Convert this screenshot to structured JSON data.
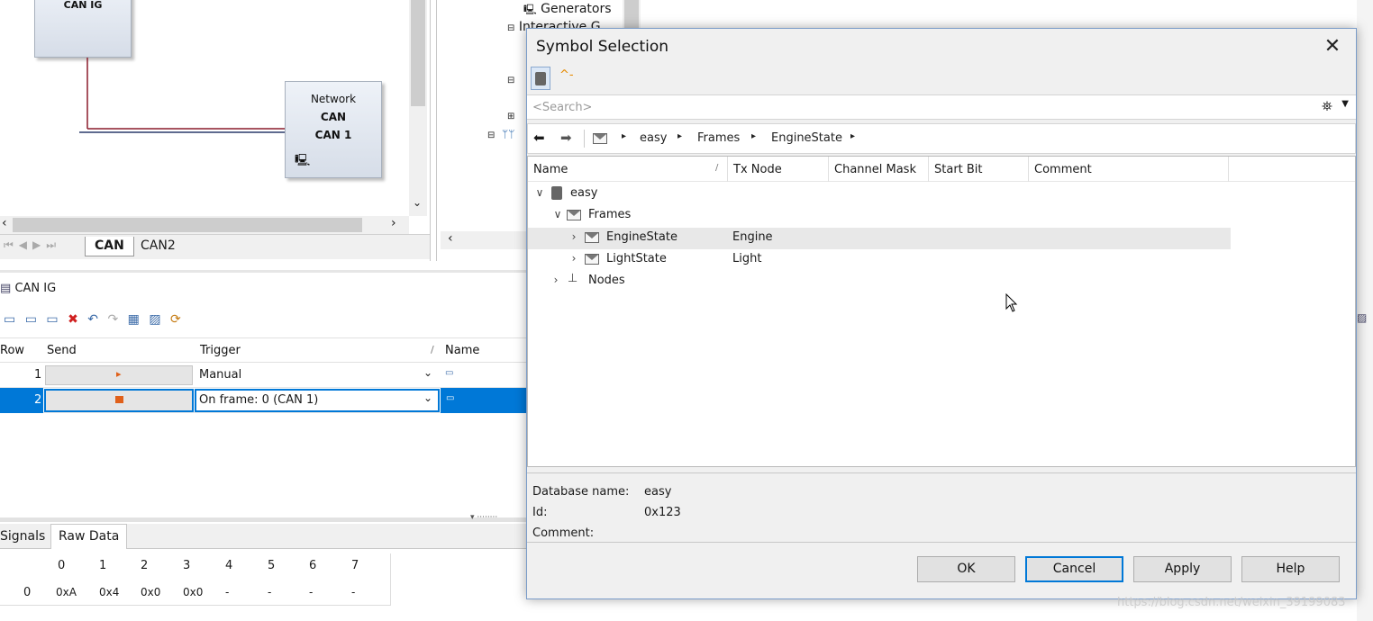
{
  "diagram": {
    "node_top_label": "CAN IG",
    "network_node": {
      "line1": "Network",
      "line2": "CAN",
      "line3": "CAN 1"
    },
    "sheet_tabs": [
      "CAN",
      "CAN2"
    ]
  },
  "tree": {
    "items": [
      "Generators",
      "Interactive G..."
    ]
  },
  "canig": {
    "title": "CAN IG",
    "columns": {
      "row": "Row",
      "send": "Send",
      "trigger": "Trigger",
      "name": "Name"
    },
    "rows": [
      {
        "row": "1",
        "trigger": "Manual"
      },
      {
        "row": "2",
        "trigger": "On frame: 0 (CAN 1)"
      }
    ]
  },
  "rawdata": {
    "tabs": [
      "Signals",
      "Raw Data"
    ],
    "byte_headers": [
      "0",
      "1",
      "2",
      "3",
      "4",
      "5",
      "6",
      "7"
    ],
    "row_label": "0",
    "values": [
      "0xA",
      "0x4",
      "0x0",
      "0x0",
      "-",
      "-",
      "-",
      "-"
    ]
  },
  "dialog": {
    "title": "Symbol Selection",
    "search_placeholder": "<Search>",
    "breadcrumb": [
      "easy",
      "Frames",
      "EngineState"
    ],
    "columns": [
      "Name",
      "Tx Node",
      "Channel Mask",
      "Start Bit",
      "Comment"
    ],
    "tree": {
      "db": "easy",
      "frames": "Frames",
      "items": [
        {
          "name": "EngineState",
          "tx": "Engine"
        },
        {
          "name": "LightState",
          "tx": "Light"
        }
      ],
      "nodes": "Nodes"
    },
    "details": {
      "db_label": "Database name:",
      "db_value": "easy",
      "id_label": "Id:",
      "id_value": "0x123",
      "comment_label": "Comment:"
    },
    "buttons": {
      "ok": "OK",
      "cancel": "Cancel",
      "apply": "Apply",
      "help": "Help"
    }
  },
  "watermark": "https://blog.csdn.net/weixin_39199083",
  "colors": {
    "selection": "#0078d7",
    "row_highlight": "#e8e8e8"
  }
}
